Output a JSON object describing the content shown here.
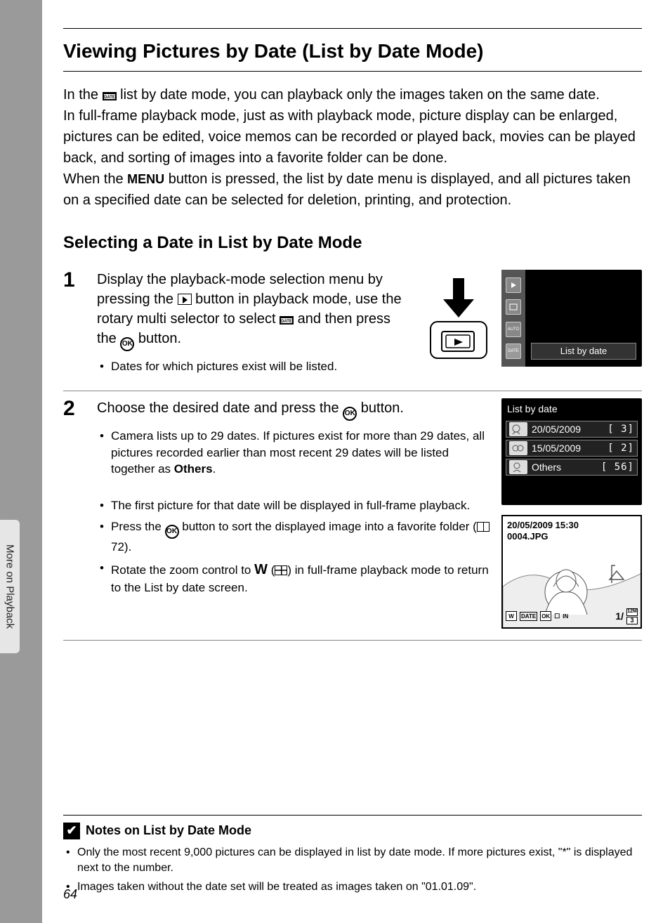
{
  "sideTab": "More on Playback",
  "pageNumber": "64",
  "title": "Viewing Pictures by Date (List by Date Mode)",
  "intro": {
    "p1a": "In the ",
    "p1b": " list by date mode, you can playback only the images taken on the same date.",
    "p2": "In full-frame playback mode, just as with playback mode, picture display can be enlarged, pictures can be edited, voice memos can be recorded or played back, movies can be played back, and sorting of images into a favorite folder can be done.",
    "p3a": "When the ",
    "menu": "MENU",
    "p3b": " button is pressed, the list by date menu is displayed, and all pictures taken on a specified date can be selected for deletion, printing, and protection."
  },
  "subheading": "Selecting a Date in List by Date Mode",
  "step1": {
    "num": "1",
    "t1": "Display the playback-mode selection menu by pressing the ",
    "t2": " button in playback mode, use the rotary multi selector to select ",
    "t3": " and then press the ",
    "t4": " button.",
    "bullet": "Dates for which pictures exist will be listed."
  },
  "screen1": {
    "label": "List by date"
  },
  "step2": {
    "num": "2",
    "t1": "Choose the desired date and press the ",
    "t2": " button.",
    "b1a": "Camera lists up to 29 dates. If pictures exist for more than 29 dates, all pictures recorded earlier than most recent 29 dates will be listed together as ",
    "b1b": "Others",
    "b1c": ".",
    "b2": "The first picture for that date will be displayed in full-frame playback.",
    "b3a": "Press the ",
    "b3b": " button to sort the displayed image into a favorite folder (",
    "b3c": "72).",
    "b4a": "Rotate the zoom control to ",
    "b4w": "W",
    "b4b": " (",
    "b4c": ") in full-frame playback mode to return to the List by date screen."
  },
  "screen2": {
    "title": "List by date",
    "rows": [
      {
        "date": "20/05/2009",
        "count": "[   3]"
      },
      {
        "date": "15/05/2009",
        "count": "[   2]"
      },
      {
        "date": "Others",
        "count": "[  56]"
      }
    ]
  },
  "screen3": {
    "ts": "20/05/2009 15:30",
    "file": "0004.JPG",
    "counter": "1/",
    "badge1": "12M",
    "badge2": "3"
  },
  "notes": {
    "head": "Notes on List by Date Mode",
    "n1": "Only the most recent 9,000 pictures can be displayed in list by date mode. If more pictures exist, \"*\" is displayed next to the number.",
    "n2": "Images taken without the date set will be treated as images taken on \"01.01.09\"."
  }
}
